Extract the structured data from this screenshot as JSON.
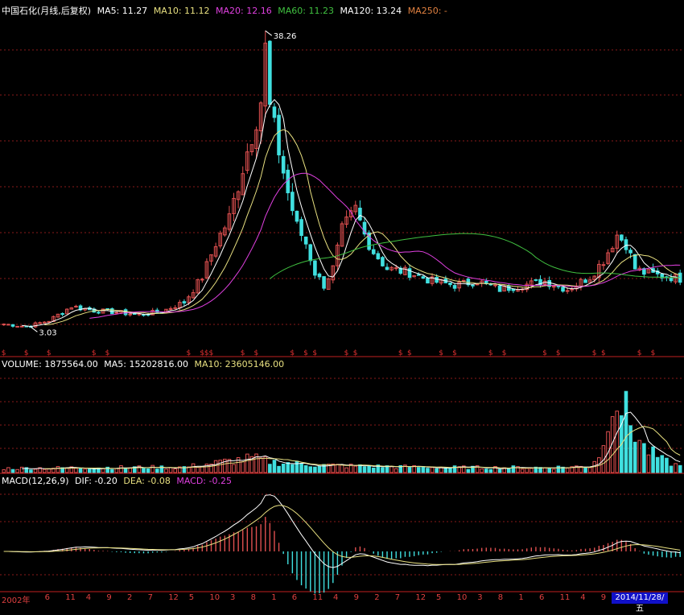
{
  "price_header": {
    "title": "中国石化(月线,后复权)",
    "ma5": "MA5: 11.27",
    "ma10": "MA10: 11.12",
    "ma20": "MA20: 12.16",
    "ma60": "MA60: 11.23",
    "ma120": "MA120: 13.24",
    "ma250": "MA250: -"
  },
  "volume_header": {
    "volume": "VOLUME: 1875564.00",
    "ma5": "MA5: 15202816.00",
    "ma10": "MA10: 23605146.00"
  },
  "macd_header": {
    "label": "MACD(12,26,9)",
    "dif": "DIF: -0.20",
    "dea": "DEA: -0.08",
    "macd": "MACD: -0.25"
  },
  "date_badge": "2014/11/28/五",
  "colors": {
    "up": "#e05050",
    "down": "#40e0e0",
    "ma5": "#ffffff",
    "ma10": "#e8e080",
    "ma20": "#e040e0",
    "ma60": "#40c040",
    "grid": "#8a1a1a",
    "divider": "#c02020",
    "dif": "#ffffff",
    "dea": "#e8e080",
    "macd_label": "#e040e0"
  },
  "x_axis_ticks": [
    "2002年",
    "6",
    "11",
    "4",
    "9",
    "2",
    "7",
    "12",
    "5",
    "10",
    "3",
    "8",
    "1",
    "6",
    "11",
    "4",
    "9",
    "2",
    "7",
    "12",
    "5",
    "10",
    "3",
    "8",
    "1",
    "6",
    "11",
    "4",
    "9",
    "2"
  ],
  "chart_data": [
    {
      "type": "line",
      "title": "中国石化(月线,后复权)",
      "x_range": [
        0,
        150
      ],
      "ylim": [
        0,
        40
      ],
      "annotations": [
        {
          "text": "38.26",
          "x": 58,
          "y": 38.26,
          "kind": "high"
        },
        {
          "text": "3.03",
          "x": 6,
          "y": 3.03,
          "kind": "low"
        }
      ],
      "close_anchors": [
        [
          0,
          3.4
        ],
        [
          5,
          3.1
        ],
        [
          10,
          3.8
        ],
        [
          15,
          5.5
        ],
        [
          20,
          5.0
        ],
        [
          25,
          4.8
        ],
        [
          30,
          4.5
        ],
        [
          35,
          4.9
        ],
        [
          40,
          6.0
        ],
        [
          44,
          9.0
        ],
        [
          47,
          13.0
        ],
        [
          50,
          16.0
        ],
        [
          53,
          22.0
        ],
        [
          55,
          26.0
        ],
        [
          57,
          30.0
        ],
        [
          58,
          36.0
        ],
        [
          59,
          29.0
        ],
        [
          61,
          24.0
        ],
        [
          63,
          19.0
        ],
        [
          65,
          15.0
        ],
        [
          67,
          13.0
        ],
        [
          69,
          9.5
        ],
        [
          71,
          8.0
        ],
        [
          73,
          10.0
        ],
        [
          75,
          14.5
        ],
        [
          78,
          17.0
        ],
        [
          80,
          14.0
        ],
        [
          82,
          12.0
        ],
        [
          85,
          10.0
        ],
        [
          90,
          9.5
        ],
        [
          95,
          8.5
        ],
        [
          100,
          8.0
        ],
        [
          105,
          8.5
        ],
        [
          110,
          7.5
        ],
        [
          115,
          8.0
        ],
        [
          120,
          8.5
        ],
        [
          125,
          7.5
        ],
        [
          130,
          9.0
        ],
        [
          133,
          11.0
        ],
        [
          136,
          14.0
        ],
        [
          138,
          13.0
        ],
        [
          140,
          10.0
        ],
        [
          142,
          9.5
        ],
        [
          145,
          9.2
        ],
        [
          148,
          9.0
        ],
        [
          150,
          8.8
        ]
      ],
      "series": [
        {
          "name": "MA5",
          "period": 5
        },
        {
          "name": "MA10",
          "period": 10
        },
        {
          "name": "MA20",
          "period": 20
        },
        {
          "name": "MA60",
          "period": 60
        }
      ]
    },
    {
      "type": "bar",
      "title": "VOLUME",
      "series": [
        {
          "name": "MA5"
        },
        {
          "name": "MA10"
        }
      ],
      "volume_anchors": [
        [
          0,
          1.0
        ],
        [
          20,
          1.2
        ],
        [
          40,
          1.3
        ],
        [
          48,
          2.5
        ],
        [
          55,
          3.5
        ],
        [
          60,
          2.5
        ],
        [
          70,
          1.8
        ],
        [
          80,
          1.5
        ],
        [
          100,
          1.2
        ],
        [
          120,
          1.2
        ],
        [
          130,
          1.5
        ],
        [
          133,
          6.0
        ],
        [
          135,
          22.0
        ],
        [
          137,
          17.0
        ],
        [
          139,
          12.0
        ],
        [
          142,
          6.0
        ],
        [
          146,
          3.0
        ],
        [
          150,
          1.5
        ]
      ],
      "ylim": [
        0,
        25
      ]
    },
    {
      "type": "bar",
      "title": "MACD(12,26,9)",
      "series": [
        {
          "name": "DIF"
        },
        {
          "name": "DEA"
        },
        {
          "name": "MACD"
        }
      ],
      "values": {
        "DIF": -0.2,
        "DEA": -0.08,
        "MACD": -0.25
      }
    }
  ]
}
